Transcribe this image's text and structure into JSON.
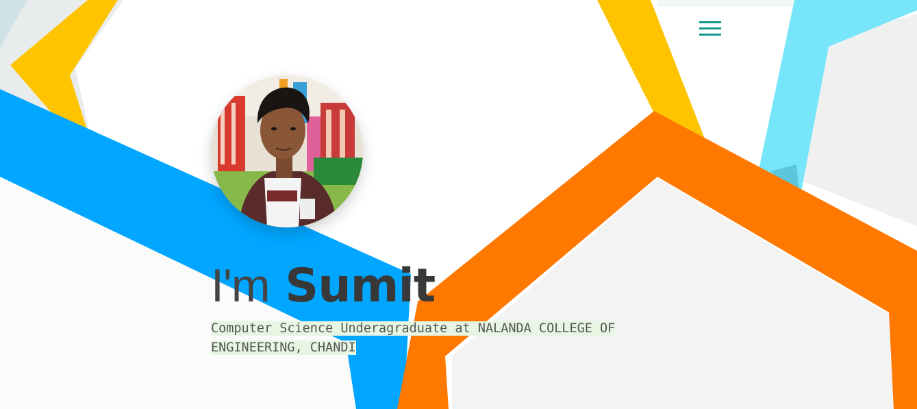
{
  "nav": {
    "menu_icon": "hamburger-menu-icon",
    "menu_color": "#12998a"
  },
  "profile": {
    "photo_alt": "profile-photo"
  },
  "hero": {
    "greeting": "I'm",
    "name": "Sumit",
    "tagline": "Computer Science Underagraduate at NALANDA COLLEGE OF ENGINEERING, CHANDI"
  },
  "colors": {
    "yellow": "#ffc400",
    "blue": "#00a6ff",
    "orange": "#ff7800",
    "light_blue": "#77e6fb",
    "highlight": "#e6f6e3"
  }
}
